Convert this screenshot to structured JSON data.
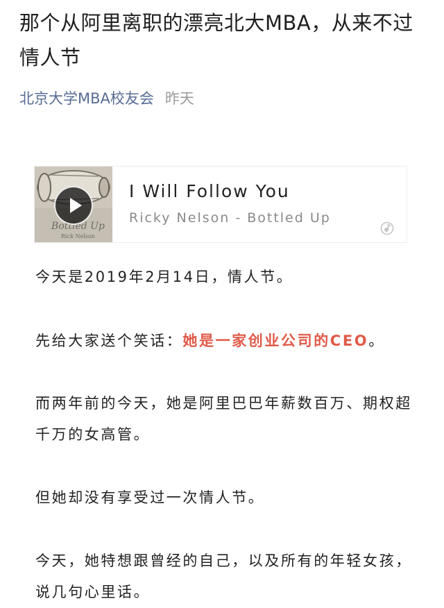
{
  "article": {
    "title": "那个从阿里离职的漂亮北大MBA，从来不过情人节",
    "account": "北京大学MBA校友会",
    "date": "昨天"
  },
  "music": {
    "song_title": "I Will Follow You",
    "artist_album": "Ricky Nelson - Bottled Up",
    "album_caption": "Bottled Up",
    "album_subcaption": "Rick Nelson",
    "play_icon": "play-icon",
    "logo_icon": "music-logo-icon"
  },
  "body": {
    "p1": "今天是2019年2月14日，情人节。",
    "p2_prefix": "先给大家送个笑话：",
    "p2_highlight": "她是一家创业公司的CEO",
    "p2_suffix": "。",
    "p3": "而两年前的今天，她是阿里巴巴年薪数百万、期权超千万的女高管。",
    "p4": "但她却没有享受过一次情人节。",
    "p5": "今天，她特想跟曾经的自己，以及所有的年轻女孩，说几句心里话。"
  },
  "colors": {
    "account": "#576b95",
    "date": "#9b9b9b",
    "highlight": "#e05a48",
    "text": "#222222"
  }
}
